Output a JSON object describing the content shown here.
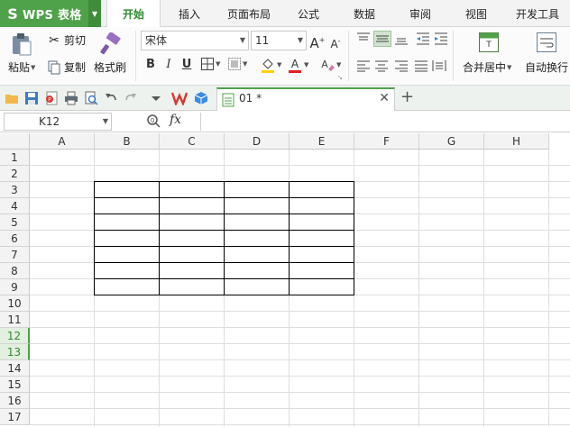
{
  "app": {
    "title": "WPS 表格",
    "logo": "S"
  },
  "tabs": [
    {
      "label": "开始",
      "active": true
    },
    {
      "label": "插入"
    },
    {
      "label": "页面布局"
    },
    {
      "label": "公式"
    },
    {
      "label": "数据"
    },
    {
      "label": "审阅"
    },
    {
      "label": "视图"
    },
    {
      "label": "开发工具"
    }
  ],
  "ribbon": {
    "paste_label": "粘贴",
    "cut_label": "剪切",
    "copy_label": "复制",
    "format_painter_label": "格式刷",
    "font_name": "宋体",
    "font_size": "11",
    "bold": "B",
    "italic": "I",
    "underline": "U",
    "merge_label": "合并居中",
    "wrap_label": "自动换行"
  },
  "document": {
    "tab_name": "01 *"
  },
  "formula": {
    "cell_ref": "K12",
    "fx": "fx"
  },
  "grid": {
    "columns": [
      "A",
      "B",
      "C",
      "D",
      "E",
      "F",
      "G",
      "H"
    ],
    "rows": [
      "1",
      "2",
      "3",
      "4",
      "5",
      "6",
      "7",
      "8",
      "9",
      "10",
      "11",
      "12",
      "13",
      "14",
      "15",
      "16",
      "17"
    ],
    "selected_rows": [
      "12",
      "13"
    ]
  },
  "colors": {
    "accent": "#4fa14a",
    "font_color": "#e02020",
    "fill_color": "#ffd000"
  }
}
